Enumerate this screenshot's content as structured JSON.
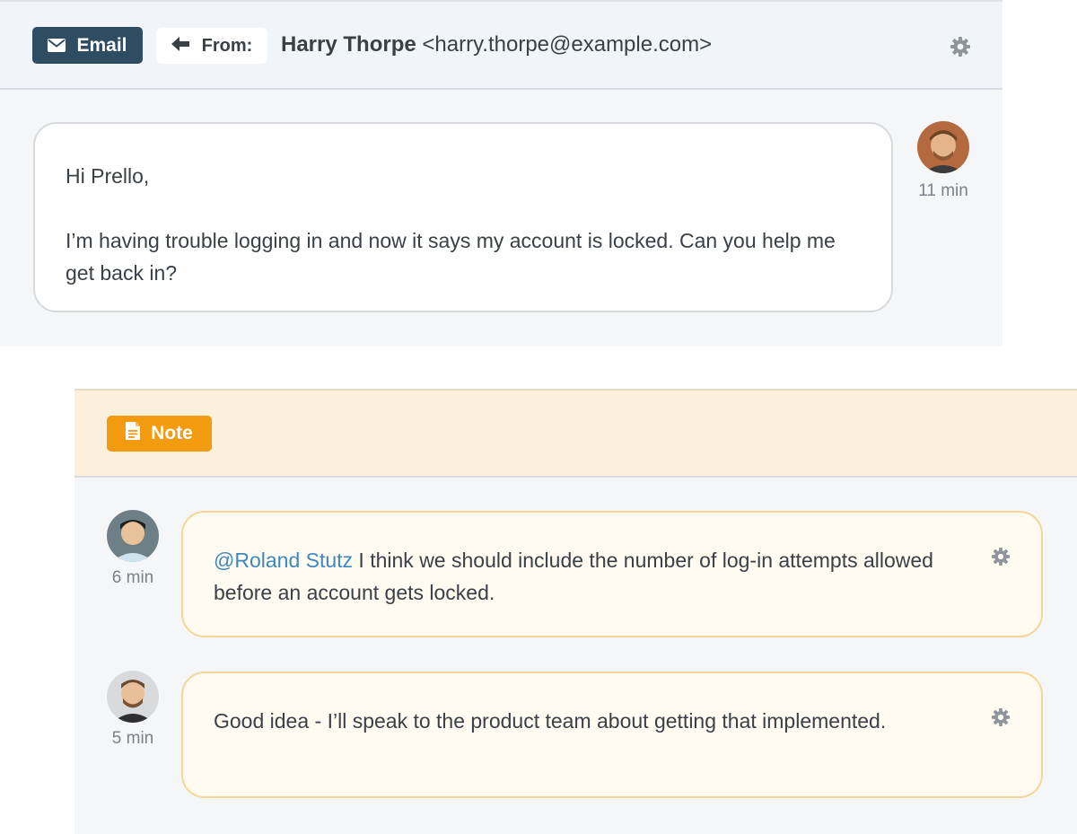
{
  "email": {
    "channel_label": "Email",
    "from_label": "From:",
    "sender_name": "Harry Thorpe",
    "sender_email": "<harry.thorpe@example.com>",
    "message": {
      "greeting": "Hi Prello,",
      "body": "I’m having trouble logging in and now it says my account is locked.  Can you help me get back in?",
      "time": "11 min"
    }
  },
  "note": {
    "label": "Note",
    "comments": [
      {
        "mention": "@Roland Stutz",
        "text": " I think we should include the number of log-in attempts allowed before an account gets locked.",
        "time": "6 min"
      },
      {
        "text": "Good idea - I’ll speak to the product team about getting that implemented.",
        "time": "5 min"
      }
    ]
  },
  "icons": {
    "email_badge": "envelope-icon",
    "from": "arrow-left-icon",
    "settings": "gear-icon",
    "note_badge": "document-icon"
  },
  "colors": {
    "email_badge": "#2e4d63",
    "note_badge": "#f29b0f",
    "mention": "#3f87bf",
    "note_bubble_border": "#f6d597"
  }
}
